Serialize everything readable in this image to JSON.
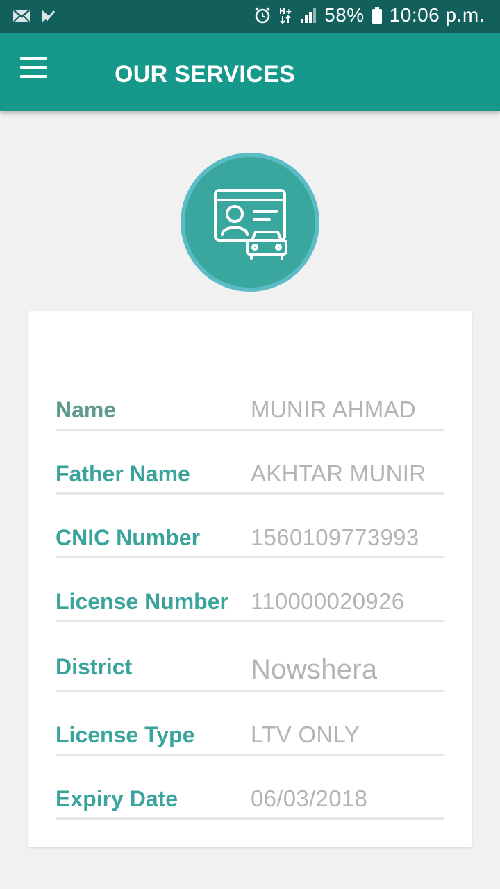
{
  "status_bar": {
    "battery": "58%",
    "time": "10:06 p.m.",
    "icons": [
      "mail-icon",
      "task-check-icon",
      "alarm-icon",
      "hplus-data-icon",
      "signal-icon",
      "battery-icon"
    ]
  },
  "app_bar": {
    "title": "OUR SERVICES",
    "menu_icon": "hamburger-menu-icon"
  },
  "emblem": {
    "icon": "driving-license-car-icon"
  },
  "details": [
    {
      "label": "Name",
      "value": "MUNIR AHMAD"
    },
    {
      "label": "Father Name",
      "value": "AKHTAR MUNIR"
    },
    {
      "label": "CNIC Number",
      "value": "1560109773993"
    },
    {
      "label": "License Number",
      "value": "110000020926"
    },
    {
      "label": "District",
      "value": "Nowshera"
    },
    {
      "label": "License Type",
      "value": "LTV ONLY"
    },
    {
      "label": "Expiry Date",
      "value": "06/03/2018"
    }
  ],
  "colors": {
    "status_bar": "#125f5c",
    "app_bar": "#16998a",
    "label": "#3aa39b",
    "value": "#b4b4b4",
    "emblem": "#3aa79e",
    "emblem_ring": "#5bbcc6"
  }
}
